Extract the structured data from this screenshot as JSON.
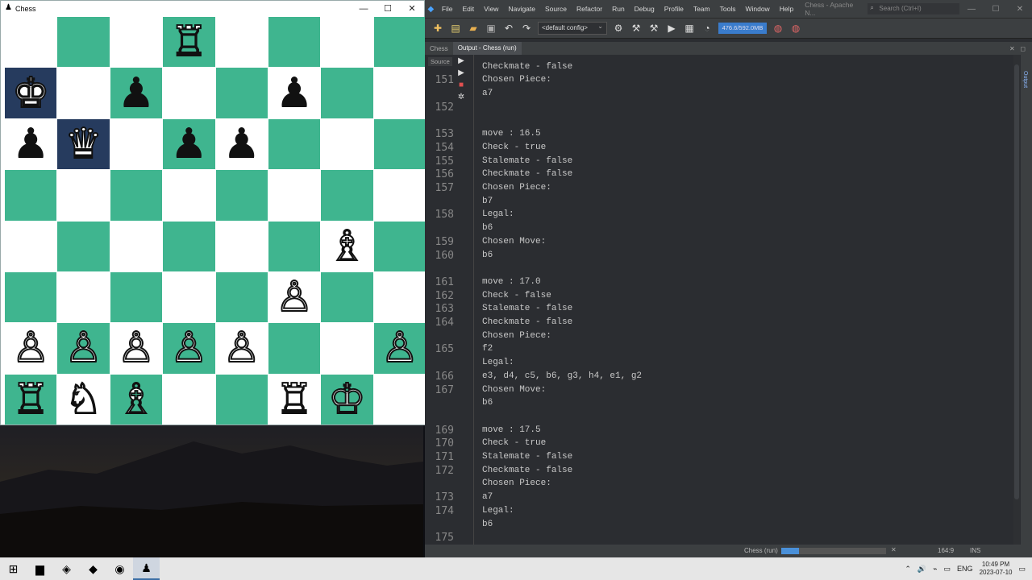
{
  "chess_window": {
    "title": "Chess",
    "app_icon": "pawn-icon",
    "board": [
      [
        "",
        "",
        "",
        "♖",
        "",
        "",
        "",
        ""
      ],
      [
        "♚",
        "",
        "♟",
        "",
        "",
        "♟",
        "",
        ""
      ],
      [
        "♟",
        "♛",
        "",
        "♟",
        "♟",
        "",
        "",
        ""
      ],
      [
        "",
        "",
        "",
        "",
        "",
        "",
        "",
        ""
      ],
      [
        "",
        "",
        "",
        "",
        "",
        "",
        "♗",
        ""
      ],
      [
        "",
        "",
        "",
        "",
        "",
        "♙",
        "",
        ""
      ],
      [
        "♙",
        "♙",
        "♙",
        "♙",
        "♙",
        "",
        "",
        "♙"
      ],
      [
        "♖",
        "♘",
        "♗",
        "",
        "",
        "♖",
        "♔",
        ""
      ]
    ],
    "colors": {
      "light": "#ffffff",
      "dark": "#3fb58f",
      "selected": "#263b5e"
    }
  },
  "ide": {
    "menu": [
      "File",
      "Edit",
      "View",
      "Navigate",
      "Source",
      "Refactor",
      "Run",
      "Debug",
      "Profile",
      "Team",
      "Tools",
      "Window",
      "Help"
    ],
    "window_title": "Chess - Apache N...",
    "search_placeholder": "Search (Ctrl+I)",
    "config": "<default config>",
    "memory": "476.6/592.0MB",
    "output_tab_left": "Chess",
    "output_tab": "Output - Chess (run)",
    "source_tab": "Source",
    "right_strip": "Output",
    "lines": [
      {
        "n": "",
        "t": "Stalemate - false"
      },
      {
        "n": "",
        "t": "Checkmate - false"
      },
      {
        "n": "151",
        "t": "Chosen Piece:"
      },
      {
        "n": "",
        "t": "a7"
      },
      {
        "n": "152",
        "t": ""
      },
      {
        "n": "",
        "t": ""
      },
      {
        "n": "153",
        "t": "move : 16.5"
      },
      {
        "n": "154",
        "t": "Check - true"
      },
      {
        "n": "155",
        "t": "Stalemate - false"
      },
      {
        "n": "156",
        "t": "Checkmate - false"
      },
      {
        "n": "157",
        "t": "Chosen Piece:"
      },
      {
        "n": "",
        "t": "b7"
      },
      {
        "n": "158",
        "t": "Legal:"
      },
      {
        "n": "",
        "t": "b6"
      },
      {
        "n": "159",
        "t": "Chosen Move:"
      },
      {
        "n": "160",
        "t": "b6"
      },
      {
        "n": "",
        "t": ""
      },
      {
        "n": "161",
        "t": "move : 17.0"
      },
      {
        "n": "162",
        "t": "Check - false"
      },
      {
        "n": "163",
        "t": "Stalemate - false"
      },
      {
        "n": "164",
        "t": "Checkmate - false"
      },
      {
        "n": "",
        "t": "Chosen Piece:"
      },
      {
        "n": "165",
        "t": "f2"
      },
      {
        "n": "",
        "t": "Legal:"
      },
      {
        "n": "166",
        "t": "e3, d4, c5, b6, g3, h4, e1, g2"
      },
      {
        "n": "167",
        "t": "Chosen Move:"
      },
      {
        "n": "",
        "t": "b6"
      },
      {
        "n": "",
        "t": ""
      },
      {
        "n": "169",
        "t": "move : 17.5"
      },
      {
        "n": "170",
        "t": "Check - true"
      },
      {
        "n": "171",
        "t": "Stalemate - false"
      },
      {
        "n": "172",
        "t": "Checkmate - false"
      },
      {
        "n": "",
        "t": "Chosen Piece:"
      },
      {
        "n": "173",
        "t": "a7"
      },
      {
        "n": "174",
        "t": "Legal:"
      },
      {
        "n": "",
        "t": "b6"
      },
      {
        "n": "175",
        "t": ""
      }
    ],
    "status": {
      "run": "Chess (run)",
      "progress": 0.17,
      "position": "164:9",
      "mode": "INS"
    }
  },
  "taskbar": {
    "apps": [
      {
        "name": "start-icon",
        "glyph": "⊞"
      },
      {
        "name": "file-explorer-icon",
        "glyph": "▆"
      },
      {
        "name": "brave-icon",
        "glyph": "◈"
      },
      {
        "name": "netbeans-icon",
        "glyph": "◆"
      },
      {
        "name": "obs-icon",
        "glyph": "◉"
      },
      {
        "name": "java-app-icon",
        "glyph": "♟"
      }
    ],
    "tray": {
      "lang": "ENG",
      "time": "10:49 PM",
      "date": "2023-07-10"
    }
  }
}
